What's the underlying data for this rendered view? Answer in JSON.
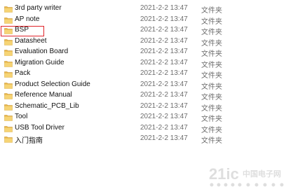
{
  "files": [
    {
      "name": "3rd party writer",
      "date": "2021-2-2 13:47",
      "type": "文件夹"
    },
    {
      "name": "AP note",
      "date": "2021-2-2 13:47",
      "type": "文件夹"
    },
    {
      "name": "BSP",
      "date": "2021-2-2 13:47",
      "type": "文件夹",
      "highlighted": true
    },
    {
      "name": "Datasheet",
      "date": "2021-2-2 13:47",
      "type": "文件夹"
    },
    {
      "name": "Evaluation Board",
      "date": "2021-2-2 13:47",
      "type": "文件夹"
    },
    {
      "name": "Migration Guide",
      "date": "2021-2-2 13:47",
      "type": "文件夹"
    },
    {
      "name": "Pack",
      "date": "2021-2-2 13:47",
      "type": "文件夹"
    },
    {
      "name": "Product Selection Guide",
      "date": "2021-2-2 13:47",
      "type": "文件夹"
    },
    {
      "name": "Reference Manual",
      "date": "2021-2-2 13:47",
      "type": "文件夹"
    },
    {
      "name": "Schematic_PCB_Lib",
      "date": "2021-2-2 13:47",
      "type": "文件夹"
    },
    {
      "name": "Tool",
      "date": "2021-2-2 13:47",
      "type": "文件夹"
    },
    {
      "name": "USB Tool Driver",
      "date": "2021-2-2 13:47",
      "type": "文件夹"
    },
    {
      "name": "入门指南",
      "date": "2021-2-2 13:47",
      "type": "文件夹"
    }
  ],
  "icon": "folder-icon",
  "colors": {
    "highlight_border": "#e0232a",
    "folder": "#e8b64c"
  },
  "watermark": {
    "brand": "21ic",
    "chinese": "中国电子网"
  }
}
